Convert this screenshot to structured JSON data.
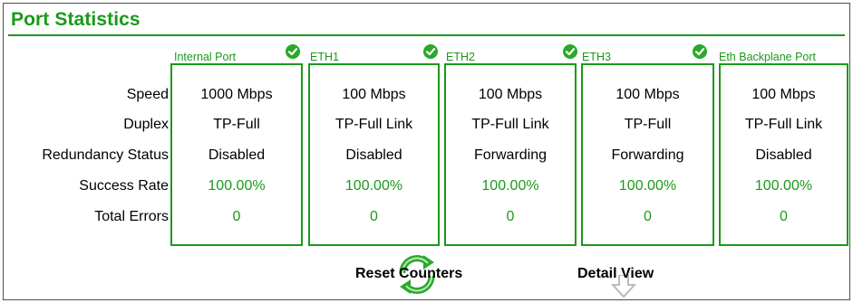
{
  "title": "Port Statistics",
  "row_labels": [
    "Speed",
    "Duplex",
    "Redundancy Status",
    "Success Rate",
    "Total Errors"
  ],
  "ports": [
    {
      "name": "Internal Port",
      "speed": "1000 Mbps",
      "duplex": "TP-Full",
      "redundancy": "Disabled",
      "success_rate": "100.00%",
      "total_errors": "0"
    },
    {
      "name": "ETH1",
      "speed": "100 Mbps",
      "duplex": "TP-Full Link",
      "redundancy": "Disabled",
      "success_rate": "100.00%",
      "total_errors": "0"
    },
    {
      "name": "ETH2",
      "speed": "100 Mbps",
      "duplex": "TP-Full Link",
      "redundancy": "Forwarding",
      "success_rate": "100.00%",
      "total_errors": "0"
    },
    {
      "name": "ETH3",
      "speed": "100 Mbps",
      "duplex": "TP-Full",
      "redundancy": "Forwarding",
      "success_rate": "100.00%",
      "total_errors": "0"
    },
    {
      "name": "Eth Backplane Port",
      "speed": "100 Mbps",
      "duplex": "TP-Full Link",
      "redundancy": "Disabled",
      "success_rate": "100.00%",
      "total_errors": "0"
    }
  ],
  "buttons": {
    "reset": "Reset Counters",
    "detail": "Detail View"
  },
  "colors": {
    "accent": "#1a9a1a",
    "check": "#2aa82a",
    "icon_gray": "#c0c0c0"
  },
  "icons": {
    "status": "checkmark-circle-icon",
    "reset": "refresh-arrows-icon",
    "detail": "down-arrow-icon"
  }
}
